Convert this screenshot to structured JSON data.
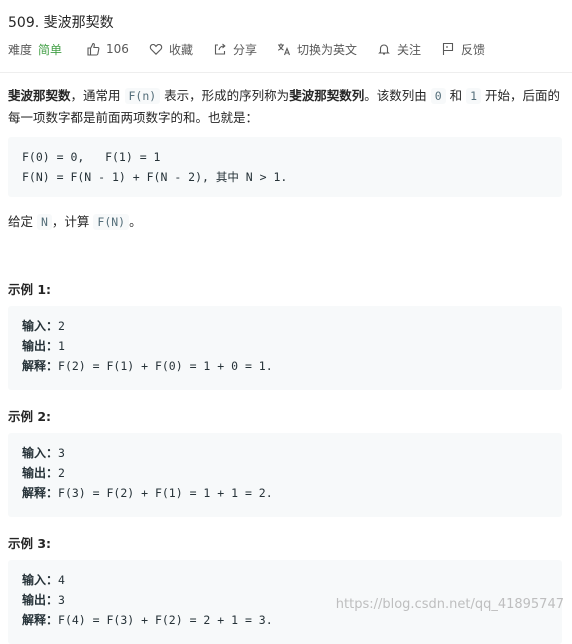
{
  "header": {
    "title": "509. 斐波那契数",
    "difficulty_label": "难度",
    "difficulty": "简单",
    "likes_count": "106",
    "favorite_label": "收藏",
    "share_label": "分享",
    "translate_label": "切换为英文",
    "follow_label": "关注",
    "feedback_label": "反馈"
  },
  "description": {
    "p1_term": "斐波那契数",
    "p1_a": "，通常用 ",
    "p1_code_fn": "F(n)",
    "p1_b": " 表示，形成的序列称为",
    "p1_seq": "斐波那契数列",
    "p1_c": "。该数列由 ",
    "p1_code_0": "0",
    "p1_d": " 和 ",
    "p1_code_1": "1",
    "p1_e": " 开始，后面的每一项数字都是前面两项数字的和。也就是："
  },
  "definition": {
    "line1": "F(0) = 0,   F(1) = 1",
    "line2": "F(N) = F(N - 1) + F(N - 2), 其中 N > 1."
  },
  "given": {
    "a": "给定 ",
    "code_n": "N",
    "b": "，计算 ",
    "code_fn": "F(N)",
    "c": "。"
  },
  "examples": [
    {
      "title": "示例 1:",
      "input_label": "输入：",
      "input": "2",
      "output_label": "输出：",
      "output": "1",
      "explain_label": "解释：",
      "explain": "F(2) = F(1) + F(0) = 1 + 0 = 1."
    },
    {
      "title": "示例 2:",
      "input_label": "输入：",
      "input": "3",
      "output_label": "输出：",
      "output": "2",
      "explain_label": "解释：",
      "explain": "F(3) = F(2) + F(1) = 1 + 1 = 2."
    },
    {
      "title": "示例 3:",
      "input_label": "输入：",
      "input": "4",
      "output_label": "输出：",
      "output": "3",
      "explain_label": "解释：",
      "explain": "F(4) = F(3) + F(2) = 2 + 1 = 3."
    }
  ],
  "watermark": "https://blog.csdn.net/qq_41895747",
  "colors": {
    "difficulty_easy": "#43a047",
    "code_bg": "#f7f9fa",
    "inline_code_text": "#546e7a"
  }
}
